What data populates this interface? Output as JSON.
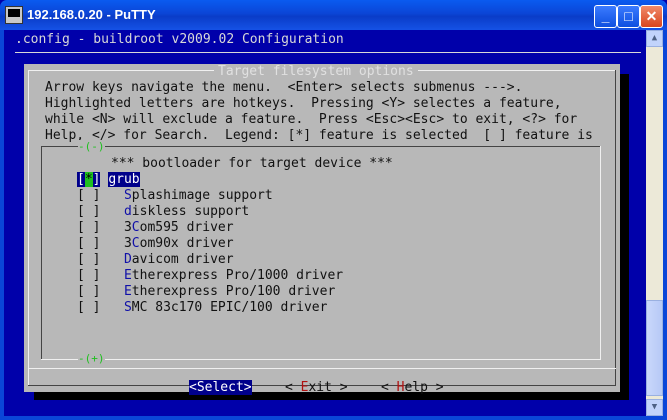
{
  "window": {
    "title": "192.168.0.20 - PuTTY",
    "controls": {
      "minimize": "_",
      "maximize": "□",
      "close": "✕"
    }
  },
  "terminal": {
    "header": ".config - buildroot v2009.02 Configuration",
    "dialog": {
      "title": "Target filesystem options",
      "help": [
        "Arrow keys navigate the menu.  <Enter> selects submenus --->.",
        "Highlighted letters are hotkeys.  Pressing <Y> selectes a feature,",
        "while <N> will exclude a feature.  Press <Esc><Esc> to exit, <?> for",
        "Help, </> for Search.  Legend: [*] feature is selected  [ ] feature is"
      ],
      "scroll_up": "-(-)",
      "scroll_down": "-(+)",
      "section_header": "*** bootloader for target device ***",
      "items": [
        {
          "mark": "*",
          "hotkey": "g",
          "rest": "rub",
          "selected": true
        },
        {
          "mark": " ",
          "hotkey": "S",
          "rest": "plashimage support",
          "selected": false
        },
        {
          "mark": " ",
          "hotkey": "d",
          "rest": "iskless support",
          "selected": false
        },
        {
          "mark": " ",
          "prefix": "3",
          "hotkey": "C",
          "rest": "om595 driver",
          "selected": false
        },
        {
          "mark": " ",
          "prefix": "3",
          "hotkey": "C",
          "rest": "om90x driver",
          "selected": false
        },
        {
          "mark": " ",
          "hotkey": "D",
          "rest": "avicom driver",
          "selected": false
        },
        {
          "mark": " ",
          "hotkey": "E",
          "rest": "therexpress Pro/1000 driver",
          "selected": false
        },
        {
          "mark": " ",
          "hotkey": "E",
          "rest": "therexpress Pro/100 driver",
          "selected": false
        },
        {
          "mark": " ",
          "hotkey": "S",
          "rest": "MC 83c170 EPIC/100 driver",
          "selected": false
        }
      ],
      "buttons": {
        "select": {
          "label": "<Select>"
        },
        "exit": {
          "pre": "< ",
          "hotkey": "E",
          "post": "xit >"
        },
        "help": {
          "pre": "< ",
          "hotkey": "H",
          "post": "elp >"
        }
      }
    }
  },
  "colors": {
    "terminal_bg": "#0000aa",
    "dialog_bg": "#b8b8b8",
    "selection": "#00008b",
    "green": "#20c020",
    "hotkey_blue": "#1010a8",
    "hotkey_red": "#b01010"
  }
}
